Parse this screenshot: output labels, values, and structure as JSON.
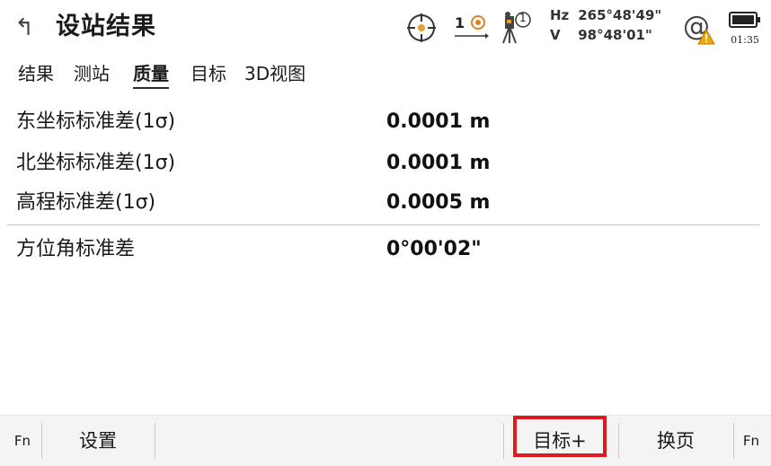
{
  "header": {
    "back_glyph": "↰",
    "title": "设站结果",
    "prism_count": "1",
    "person_badge": "1",
    "hz_label": "Hz",
    "hz_value": "265°48'49\"",
    "v_label": "V",
    "v_value": "98°48'01\"",
    "at_symbol": "@",
    "time": "01:35",
    "icons": [
      "back-icon",
      "crosshair-icon",
      "prism-icon",
      "instrument-person-icon",
      "warning-icon",
      "battery-icon"
    ]
  },
  "tabs": [
    {
      "label": "结果",
      "active": false
    },
    {
      "label": "测站",
      "active": false
    },
    {
      "label": "质量",
      "active": true
    },
    {
      "label": "目标",
      "active": false
    },
    {
      "label": "3D视图",
      "active": false
    }
  ],
  "quality": [
    {
      "label": "东坐标标准差(1σ)",
      "value": "0.0001 m"
    },
    {
      "label": "北坐标标准差(1σ)",
      "value": "0.0001 m"
    },
    {
      "label": "高程标准差(1σ)",
      "value": "0.0005 m"
    },
    {
      "label": "方位角标准差",
      "value": "0°00'02\""
    }
  ],
  "softkeys": {
    "fn_left": "Fn",
    "settings": "设置",
    "target_plus": "目标+",
    "next_page": "换页",
    "fn_right": "Fn"
  },
  "colors": {
    "highlight": "#e0191e",
    "warning": "#f0a500",
    "prism": "#e08020"
  }
}
